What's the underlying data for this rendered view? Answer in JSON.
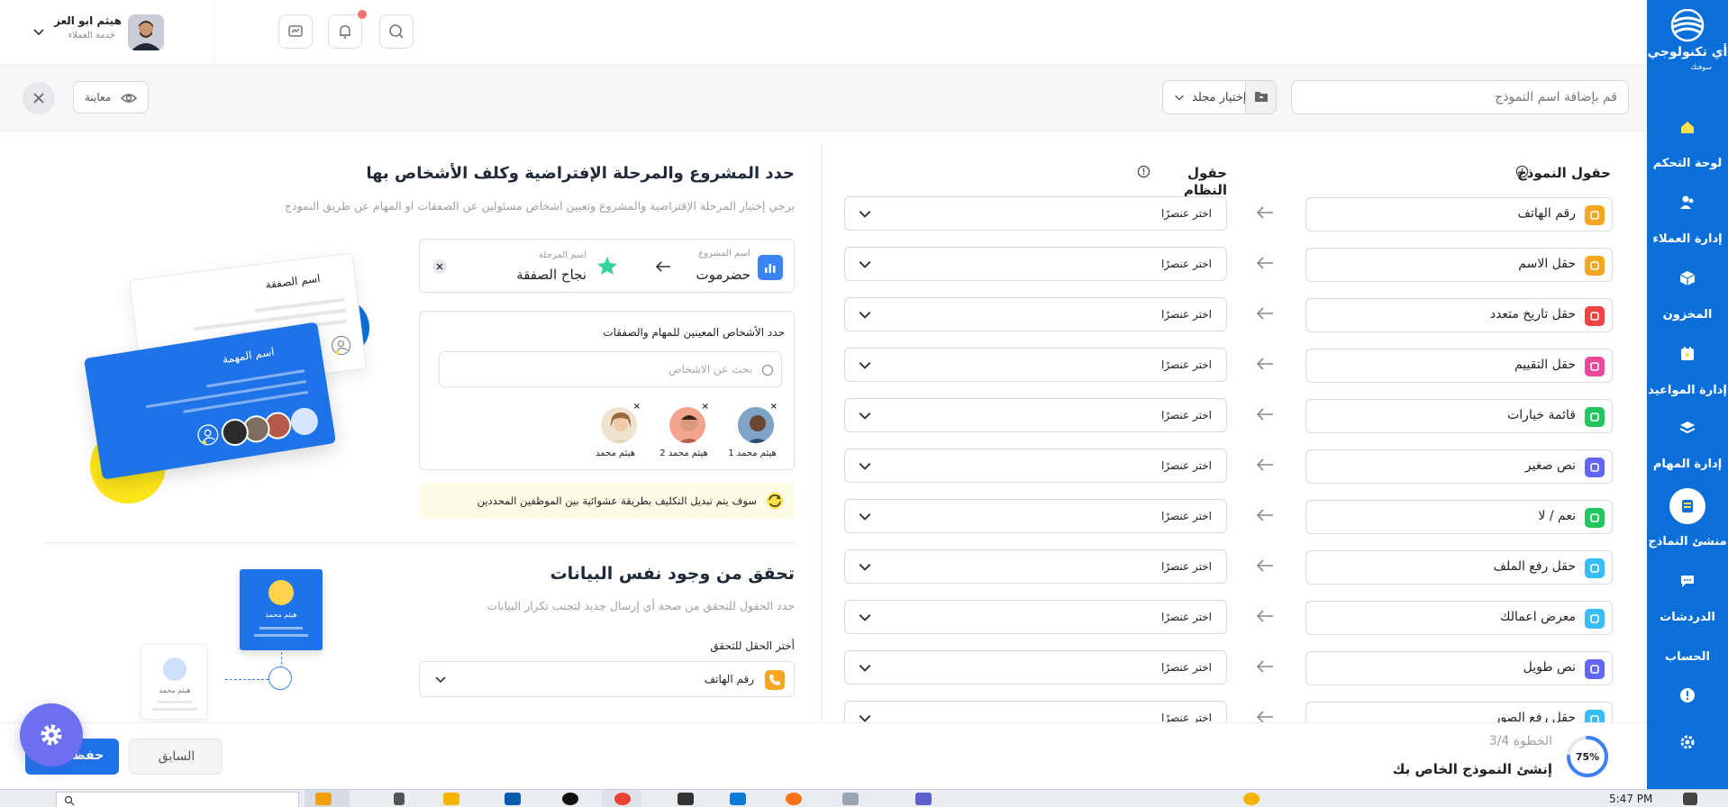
{
  "app": {
    "brand_name": "أي تكنولوجي",
    "brand_sub": "سوفتك",
    "nav": [
      {
        "label": "لوحة التحكم",
        "icon": "home-icon"
      },
      {
        "label": "إدارة العملاء",
        "icon": "users-icon"
      },
      {
        "label": "المخزون",
        "icon": "box-icon"
      },
      {
        "label": "إدارة المواعيد",
        "icon": "calendar-icon"
      },
      {
        "label": "إدارة المهام",
        "icon": "layers-icon"
      },
      {
        "label": "منشئ النماذج",
        "icon": "form-builder-icon"
      },
      {
        "label": "الدردشات",
        "icon": "chat-icon"
      },
      {
        "label": "الحساب",
        "icon": "account-icon"
      }
    ]
  },
  "header": {
    "user_name": "هيثم ابو العز",
    "user_role": "خدمة العملاء"
  },
  "toolbar": {
    "form_name_placeholder": "قم بإضافة اسم النموذج",
    "folder_label": "إختيار مجلد",
    "preview_label": "معاينة"
  },
  "mapping": {
    "form_fields_title": "حقول النموذج",
    "system_fields_title": "حقول النظام",
    "select_placeholder": "اختر عنصرًا",
    "rows": [
      {
        "label": "رقم الهاتف",
        "color": "#f5a623"
      },
      {
        "label": "حقل الاسم",
        "color": "#f5a623"
      },
      {
        "label": "حقل تاريخ متعدد",
        "color": "#ef4444"
      },
      {
        "label": "حقل التقييم",
        "color": "#ec4899"
      },
      {
        "label": "قائمة خيارات",
        "color": "#22c55e"
      },
      {
        "label": "نص صغير",
        "color": "#6366f1"
      },
      {
        "label": "نعم / لا",
        "color": "#22c55e"
      },
      {
        "label": "حقل رفع الملف",
        "color": "#38bdf8"
      },
      {
        "label": "معرض اعمالك",
        "color": "#38bdf8"
      },
      {
        "label": "نص طويل",
        "color": "#6366f1"
      },
      {
        "label": "حقل رفع الصور",
        "color": "#38bdf8"
      }
    ]
  },
  "project": {
    "title": "حدد المشروع والمرحلة الإفتراضية وكلف الأشخاص بها",
    "desc": "يرجي إختيار المرحلة الإفتراضية والمشروع وتعيين اشخاص مسئولين عن الصفقات او المهام عن طريق النموذج",
    "project_caption": "اسم المشروع",
    "project_value": "حضرموت",
    "stage_caption": "اسم المرحلة",
    "stage_value": "نجاح الصفقة",
    "assign_title": "حدد الأشخاص المعينين للمهام والصفقات",
    "search_placeholder": "بحث عن الاشخاص",
    "people": [
      "هيثم محمد 1",
      "هيثم محمد 2",
      "هيثم محمد"
    ],
    "note": "سوف يتم تبديل التكليف بطريقة عشوائية بين الموظفين المحددين",
    "illus_deal": "اسم الصفقة",
    "illus_task": "اسم المهمة"
  },
  "verify": {
    "title": "تحقق من وجود نفس البيانات",
    "desc": "حدد الحقول للتحقق من صحة أي إرسال جديد لتجنب تكرار البيانات",
    "field_label": "أختر الحقل للتحقق",
    "field_value": "رقم الهاتف",
    "illus_name": "هيثم محمد"
  },
  "footer": {
    "progress_text": "75%",
    "progress_value": 0.75,
    "step": "الخطوة 3/4",
    "subtitle": "إنشئ النموذج الخاص بك",
    "prev_label": "السابق",
    "save_label": "حفظ"
  },
  "taskbar": {
    "time": "5:47 PM"
  }
}
